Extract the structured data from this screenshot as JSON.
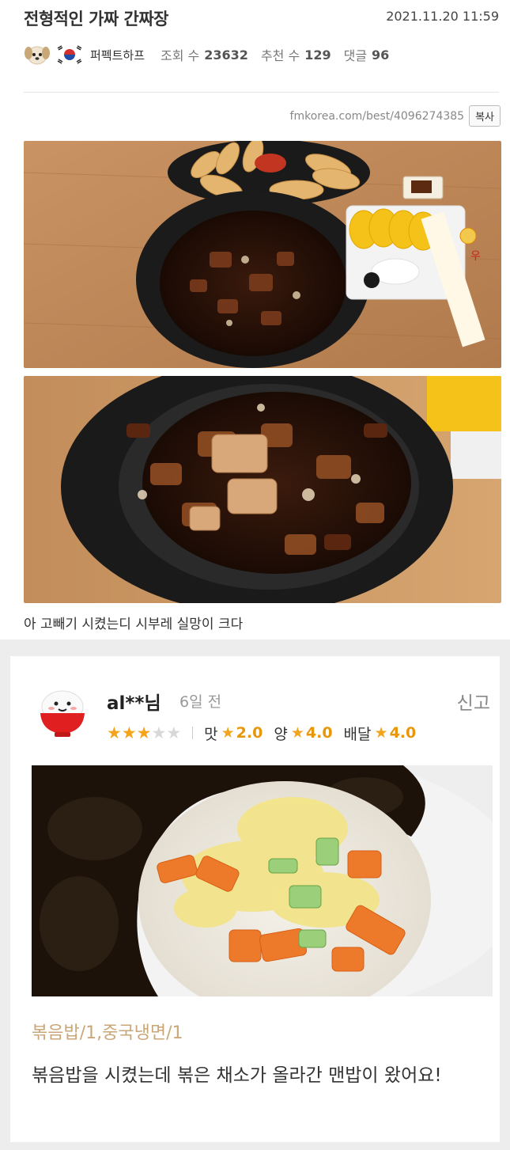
{
  "post": {
    "title": "전형적인 가짜 간짜장",
    "date": "2021.11.20 11:59",
    "author": "퍼펙트하프",
    "views_label": "조회 수",
    "views": "23632",
    "likes_label": "추천 수",
    "likes": "129",
    "comments_label": "댓글",
    "comments": "96",
    "url": "fmkorea.com/best/4096274385",
    "copy_label": "복사",
    "caption": "아 고빼기 시켰는디 시부레 실망이 크다"
  },
  "review": {
    "user": "al**님",
    "time": "6일 전",
    "report_label": "신고",
    "overall_rating": 3,
    "max_rating": 5,
    "ratings": [
      {
        "label": "맛",
        "value": "2.0"
      },
      {
        "label": "양",
        "value": "4.0"
      },
      {
        "label": "배달",
        "value": "4.0"
      }
    ],
    "menu": "볶음밥/1,중국냉면/1",
    "text": "볶음밥을 시켰는데 볶은 채소가 올라간 맨밥이 왔어요!"
  },
  "icons": {
    "star": "star-icon",
    "avatar_dog": "dog-avatar-icon",
    "avatar_flag": "korea-flag-icon",
    "rice_bowl": "rice-bowl-avatar-icon"
  },
  "colors": {
    "star_on": "#f3a41b",
    "star_off": "#d8d8d8",
    "rating_value": "#e8970a",
    "menu_text": "#c9a779"
  }
}
